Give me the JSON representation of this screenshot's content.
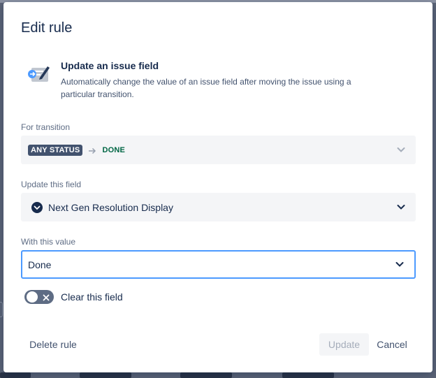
{
  "dialog": {
    "title": "Edit rule"
  },
  "summary": {
    "icon": "edit-field-icon",
    "title": "Update an issue field",
    "description": "Automatically change the value of an issue field after moving the issue using a particular transition."
  },
  "transition": {
    "label": "For transition",
    "from_status": "ANY STATUS",
    "to_status": "DONE",
    "arrow_icon": "arrow-right-icon",
    "chevron_icon": "chevron-down-icon"
  },
  "field": {
    "label": "Update this field",
    "icon": "chevron-circle-icon",
    "value": "Next Gen Resolution Display",
    "chevron_icon": "chevron-down-icon"
  },
  "value": {
    "label": "With this value",
    "selected": "Done",
    "chevron_icon": "chevron-down-icon"
  },
  "clear_toggle": {
    "label": "Clear this field",
    "state": "off"
  },
  "actions": {
    "delete_label": "Delete rule",
    "update_label": "Update",
    "cancel_label": "Cancel"
  },
  "colors": {
    "accent": "#4c9aff",
    "lozenge_dark": "#42526e",
    "done_green": "#006644",
    "text": "#172b4d",
    "muted": "#5e6c84"
  }
}
